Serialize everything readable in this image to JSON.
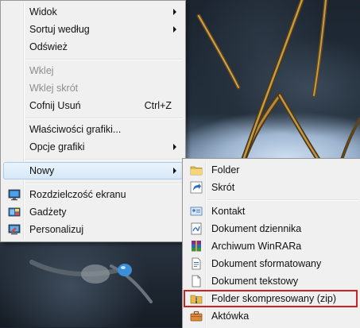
{
  "main_menu": {
    "items": [
      {
        "label": "Widok",
        "submenu": true
      },
      {
        "label": "Sortuj według",
        "submenu": true
      },
      {
        "label": "Odśwież"
      },
      {
        "label": "Wklej",
        "disabled": true
      },
      {
        "label": "Wklej skrót",
        "disabled": true
      },
      {
        "label": "Cofnij Usuń",
        "shortcut": "Ctrl+Z"
      },
      {
        "label": "Właściwości grafiki..."
      },
      {
        "label": "Opcje grafiki",
        "submenu": true
      },
      {
        "label": "Nowy",
        "submenu": true,
        "active": true
      },
      {
        "label": "Rozdzielczość ekranu",
        "icon": "display-icon"
      },
      {
        "label": "Gadżety",
        "icon": "gadgets-icon"
      },
      {
        "label": "Personalizuj",
        "icon": "personalize-icon"
      }
    ]
  },
  "sub_menu": {
    "items": [
      {
        "label": "Folder",
        "icon": "folder-icon"
      },
      {
        "label": "Skrót",
        "icon": "shortcut-icon"
      },
      {
        "label": "Kontakt",
        "icon": "contact-icon"
      },
      {
        "label": "Dokument dziennika",
        "icon": "journal-icon"
      },
      {
        "label": "Archiwum WinRARa",
        "icon": "winrar-icon"
      },
      {
        "label": "Dokument sformatowany",
        "icon": "rtf-document-icon"
      },
      {
        "label": "Dokument tekstowy",
        "icon": "text-document-icon"
      },
      {
        "label": "Folder skompresowany (zip)",
        "icon": "zip-folder-icon",
        "highlighted": true
      },
      {
        "label": "Aktówka",
        "icon": "briefcase-icon"
      }
    ]
  },
  "colors": {
    "highlight_border": "#d21f1f",
    "menu_background": "#f0f0f0",
    "hover_background": "#d6e8f8"
  }
}
